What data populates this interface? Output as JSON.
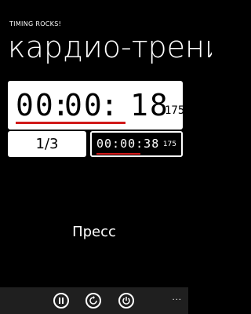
{
  "app": {
    "title": "TIMING ROCKS!"
  },
  "page": {
    "title": "кардио-тренинг"
  },
  "main_timer": {
    "hh": "00",
    "mm": "00",
    "ss": "18",
    "ms": "175"
  },
  "lap": {
    "counter": "1/3",
    "time": "00:00:38",
    "ms": "175"
  },
  "exercise": {
    "label": "Пресс"
  },
  "appbar": {
    "buttons": [
      {
        "icon": "pause-icon"
      },
      {
        "icon": "refresh-icon"
      },
      {
        "icon": "power-icon"
      }
    ],
    "more": "..."
  },
  "colors": {
    "accent": "#d11a1a",
    "background": "#000000",
    "panel": "#ffffff"
  }
}
